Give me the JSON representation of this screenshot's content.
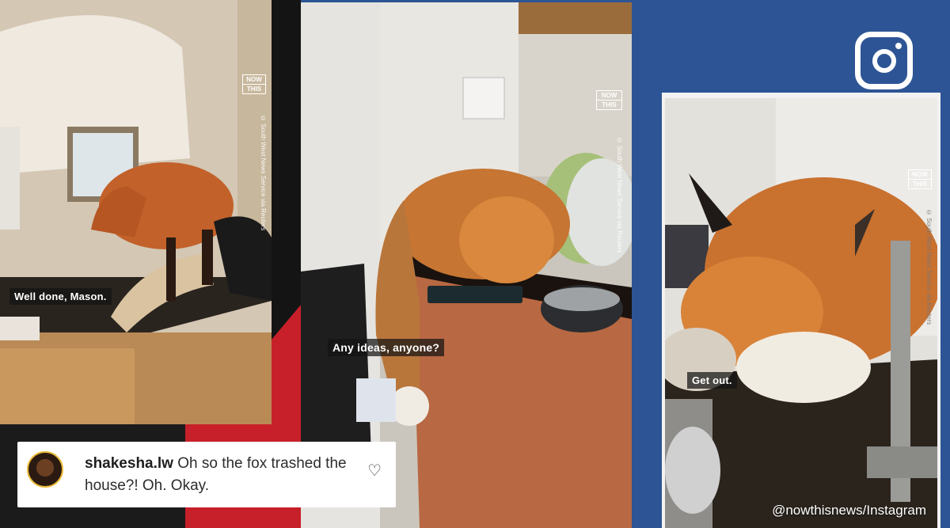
{
  "panels": [
    {
      "caption": "Well done, Mason.",
      "logo_top": "NOW",
      "logo_bottom": "THIS",
      "credit": "© South West News Service via Reuters"
    },
    {
      "caption": "Any ideas, anyone?",
      "logo_top": "NOW",
      "logo_bottom": "THIS",
      "credit": "© South West News Service via Reuters"
    },
    {
      "caption": "Get out.",
      "logo_top": "NOW",
      "logo_bottom": "THIS",
      "credit": "© South West News Service via Reuters"
    }
  ],
  "comment": {
    "username": "shakesha.lw",
    "text": " Oh so the fox trashed the house?! Oh. Okay."
  },
  "watermark": "@nowthisnews/Instagram",
  "icons": {
    "heart": "heart-icon",
    "instagram": "instagram-icon"
  },
  "colors": {
    "background": "#2d5595",
    "accent_red": "#c8202a"
  }
}
